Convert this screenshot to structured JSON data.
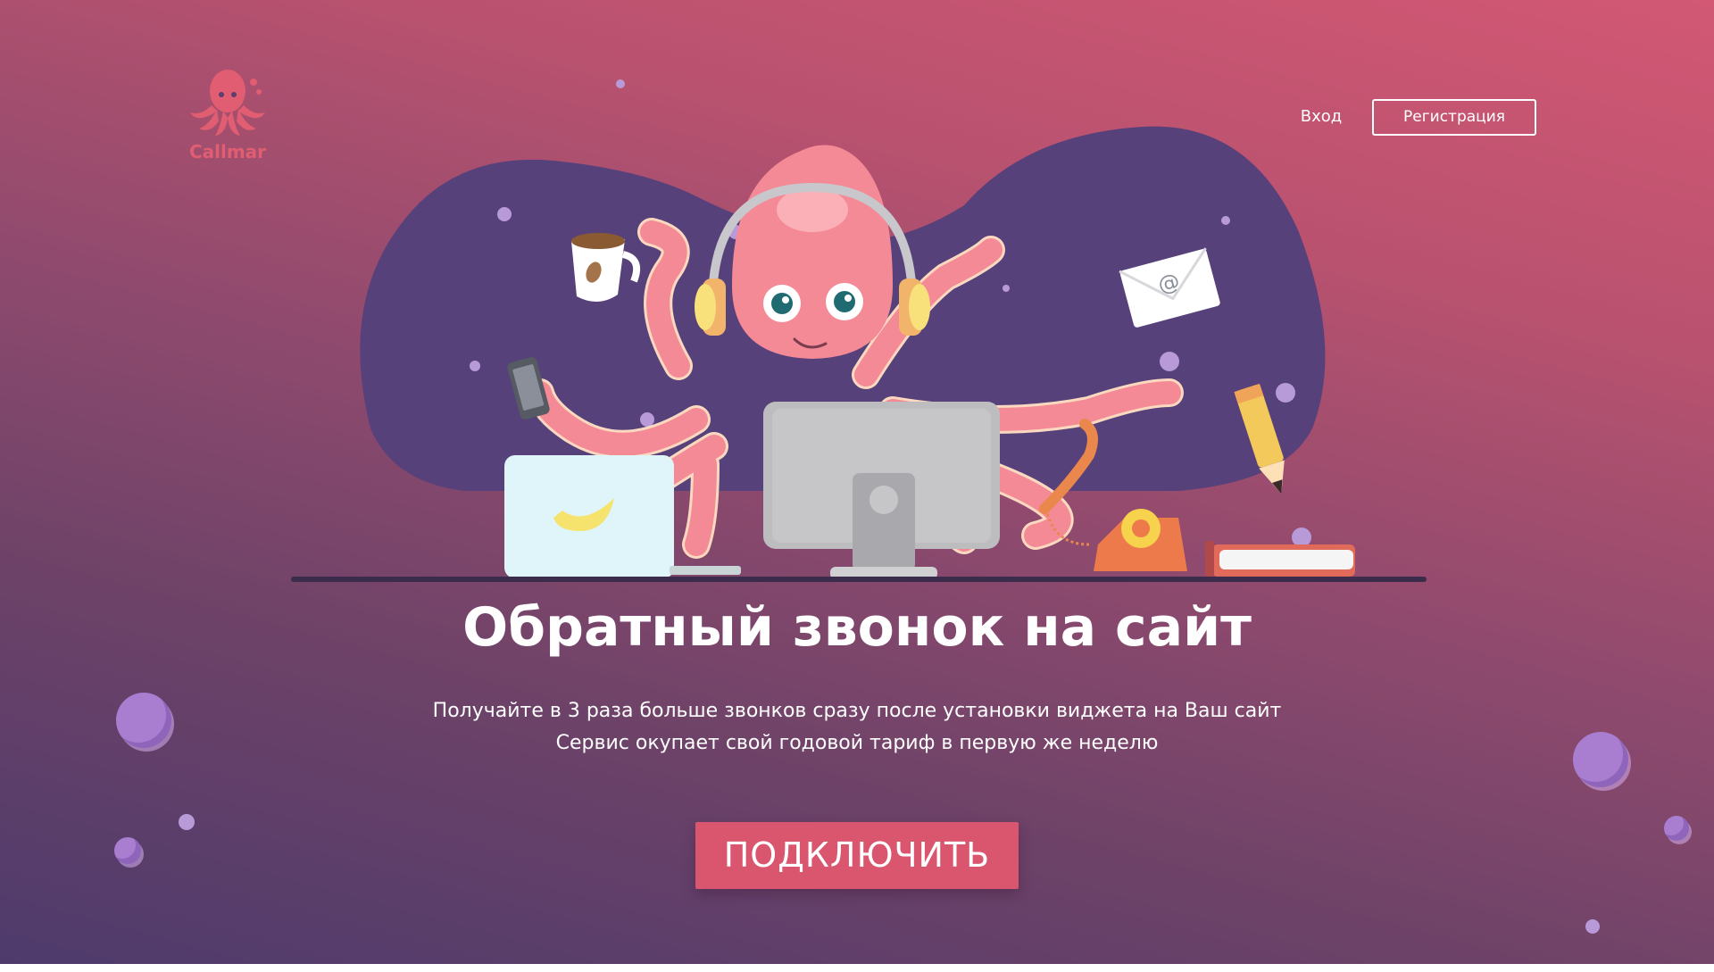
{
  "brand": {
    "name": "Callmar",
    "color": "#e05d72"
  },
  "nav": {
    "login_label": "Вход",
    "register_label": "Регистрация"
  },
  "hero": {
    "headline": "Обратный звонок на сайт",
    "subtitle_line1": "Получайте в 3 раза больше звонков сразу после установки виджета на Ваш сайт",
    "subtitle_line2": "Сервис окупает свой годовой тариф в первую же неделю",
    "cta_label": "ПОДКЛЮЧИТЬ",
    "cta_color": "#d9566e"
  },
  "illustration": {
    "subject": "octopus-call-operator",
    "envelope_symbol": "@"
  },
  "colors": {
    "gradient_start": "#4e3b6c",
    "gradient_end": "#d25874",
    "blob": "#56417a",
    "octopus": "#f58a97"
  }
}
